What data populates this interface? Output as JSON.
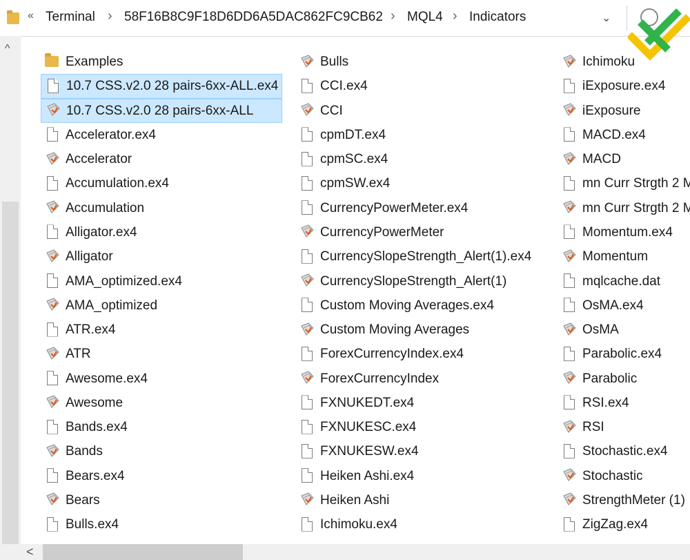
{
  "address_bar": {
    "overflow_glyph": "«",
    "breadcrumbs": [
      "Terminal",
      "58F16B8C9F18D6DD6A5DAC862FC9CB62",
      "MQL4",
      "Indicators"
    ],
    "separator": "›",
    "dropdown_glyph": "⌄"
  },
  "scrollbars": {
    "up_glyph": "^",
    "left_glyph": "<"
  },
  "columns": [
    [
      {
        "name": "Examples",
        "icon": "folder-icon"
      },
      {
        "name": "10.7 CSS.v2.0 28 pairs-6xx-ALL.ex4",
        "icon": "file-icon",
        "selected": true
      },
      {
        "name": "10.7 CSS.v2.0 28 pairs-6xx-ALL",
        "icon": "mq4-icon",
        "selected": true
      },
      {
        "name": "Accelerator.ex4",
        "icon": "file-icon"
      },
      {
        "name": "Accelerator",
        "icon": "mq4-icon"
      },
      {
        "name": "Accumulation.ex4",
        "icon": "file-icon"
      },
      {
        "name": "Accumulation",
        "icon": "mq4-icon"
      },
      {
        "name": "Alligator.ex4",
        "icon": "file-icon"
      },
      {
        "name": "Alligator",
        "icon": "mq4-icon"
      },
      {
        "name": "AMA_optimized.ex4",
        "icon": "file-icon"
      },
      {
        "name": "AMA_optimized",
        "icon": "mq4-icon"
      },
      {
        "name": "ATR.ex4",
        "icon": "file-icon"
      },
      {
        "name": "ATR",
        "icon": "mq4-icon"
      },
      {
        "name": "Awesome.ex4",
        "icon": "file-icon"
      },
      {
        "name": "Awesome",
        "icon": "mq4-icon"
      },
      {
        "name": "Bands.ex4",
        "icon": "file-icon"
      },
      {
        "name": "Bands",
        "icon": "mq4-icon"
      },
      {
        "name": "Bears.ex4",
        "icon": "file-icon"
      },
      {
        "name": "Bears",
        "icon": "mq4-icon"
      },
      {
        "name": "Bulls.ex4",
        "icon": "file-icon"
      }
    ],
    [
      {
        "name": "Bulls",
        "icon": "mq4-icon"
      },
      {
        "name": "CCI.ex4",
        "icon": "file-icon"
      },
      {
        "name": "CCI",
        "icon": "mq4-icon"
      },
      {
        "name": "cpmDT.ex4",
        "icon": "file-icon"
      },
      {
        "name": "cpmSC.ex4",
        "icon": "file-icon"
      },
      {
        "name": "cpmSW.ex4",
        "icon": "file-icon"
      },
      {
        "name": "CurrencyPowerMeter.ex4",
        "icon": "file-icon"
      },
      {
        "name": "CurrencyPowerMeter",
        "icon": "mq4-icon"
      },
      {
        "name": "CurrencySlopeStrength_Alert(1).ex4",
        "icon": "file-icon"
      },
      {
        "name": "CurrencySlopeStrength_Alert(1)",
        "icon": "mq4-icon"
      },
      {
        "name": "Custom Moving Averages.ex4",
        "icon": "file-icon"
      },
      {
        "name": "Custom Moving Averages",
        "icon": "mq4-icon"
      },
      {
        "name": "ForexCurrencyIndex.ex4",
        "icon": "file-icon"
      },
      {
        "name": "ForexCurrencyIndex",
        "icon": "mq4-icon"
      },
      {
        "name": "FXNUKEDT.ex4",
        "icon": "file-icon"
      },
      {
        "name": "FXNUKESC.ex4",
        "icon": "file-icon"
      },
      {
        "name": "FXNUKESW.ex4",
        "icon": "file-icon"
      },
      {
        "name": "Heiken Ashi.ex4",
        "icon": "file-icon"
      },
      {
        "name": "Heiken Ashi",
        "icon": "mq4-icon"
      },
      {
        "name": "Ichimoku.ex4",
        "icon": "file-icon"
      }
    ],
    [
      {
        "name": "Ichimoku",
        "icon": "mq4-icon"
      },
      {
        "name": "iExposure.ex4",
        "icon": "file-icon"
      },
      {
        "name": "iExposure",
        "icon": "mq4-icon"
      },
      {
        "name": "MACD.ex4",
        "icon": "file-icon"
      },
      {
        "name": "MACD",
        "icon": "mq4-icon"
      },
      {
        "name": "mn Curr Strgth 2 M",
        "icon": "file-icon"
      },
      {
        "name": "mn Curr Strgth 2 M",
        "icon": "mq4-icon"
      },
      {
        "name": "Momentum.ex4",
        "icon": "file-icon"
      },
      {
        "name": "Momentum",
        "icon": "mq4-icon"
      },
      {
        "name": "mqlcache.dat",
        "icon": "file-icon"
      },
      {
        "name": "OsMA.ex4",
        "icon": "file-icon"
      },
      {
        "name": "OsMA",
        "icon": "mq4-icon"
      },
      {
        "name": "Parabolic.ex4",
        "icon": "file-icon"
      },
      {
        "name": "Parabolic",
        "icon": "mq4-icon"
      },
      {
        "name": "RSI.ex4",
        "icon": "file-icon"
      },
      {
        "name": "RSI",
        "icon": "mq4-icon"
      },
      {
        "name": "Stochastic.ex4",
        "icon": "file-icon"
      },
      {
        "name": "Stochastic",
        "icon": "mq4-icon"
      },
      {
        "name": "StrengthMeter (1)",
        "icon": "mq4-icon"
      },
      {
        "name": "ZigZag.ex4",
        "icon": "file-icon"
      }
    ]
  ],
  "colors": {
    "selection_bg": "#cce8ff",
    "selection_border": "#99d1ff",
    "folder": "#e8b94a",
    "logo_green": "#2fb34a",
    "logo_yellow": "#f5c400"
  }
}
